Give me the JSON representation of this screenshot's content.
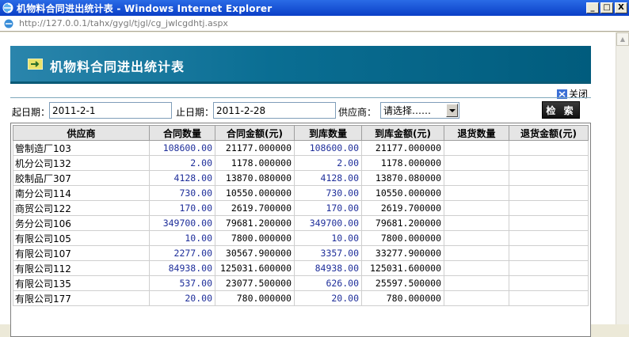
{
  "window": {
    "title": "机物料合同进出统计表 - Windows Internet Explorer",
    "min": "_",
    "max": "□",
    "close": "X"
  },
  "address": {
    "url": "http://127.0.0.1/tahx/gygl/tjgl/cg_jwlcgdhtj.aspx"
  },
  "banner": {
    "title": "机物料合同进出统计表"
  },
  "close_link": {
    "label": "关闭"
  },
  "filter": {
    "start_label": "起日期：",
    "start_value": "2011-2-1",
    "end_label": "止日期：",
    "end_value": "2011-2-28",
    "supplier_label": "供应商：",
    "supplier_value": "请选择……",
    "search_label": "检 索"
  },
  "table": {
    "headers": [
      "供应商",
      "合同数量",
      "合同金额(元)",
      "到库数量",
      "到库金额(元)",
      "退货数量",
      "退货金额(元)"
    ],
    "rows": [
      [
        "管制造厂103",
        "108600.00",
        "21177.000000",
        "108600.00",
        "21177.000000",
        "",
        ""
      ],
      [
        "机分公司132",
        "2.00",
        "1178.000000",
        "2.00",
        "1178.000000",
        "",
        ""
      ],
      [
        "胶制品厂307",
        "4128.00",
        "13870.080000",
        "4128.00",
        "13870.080000",
        "",
        ""
      ],
      [
        "南分公司114",
        "730.00",
        "10550.000000",
        "730.00",
        "10550.000000",
        "",
        ""
      ],
      [
        "商贸公司122",
        "170.00",
        "2619.700000",
        "170.00",
        "2619.700000",
        "",
        ""
      ],
      [
        "务分公司106",
        "349700.00",
        "79681.200000",
        "349700.00",
        "79681.200000",
        "",
        ""
      ],
      [
        "有限公司105",
        "10.00",
        "7800.000000",
        "10.00",
        "7800.000000",
        "",
        ""
      ],
      [
        "有限公司107",
        "2277.00",
        "30567.900000",
        "3357.00",
        "33277.900000",
        "",
        ""
      ],
      [
        "有限公司112",
        "84938.00",
        "125031.600000",
        "84938.00",
        "125031.600000",
        "",
        ""
      ],
      [
        "有限公司135",
        "537.00",
        "23077.500000",
        "626.00",
        "25597.500000",
        "",
        ""
      ],
      [
        "有限公司177",
        "20.00",
        "780.000000",
        "20.00",
        "780.000000",
        "",
        ""
      ]
    ]
  },
  "colors": {
    "banner": "#0a6e93",
    "qty_text": "#1e2e9a"
  }
}
